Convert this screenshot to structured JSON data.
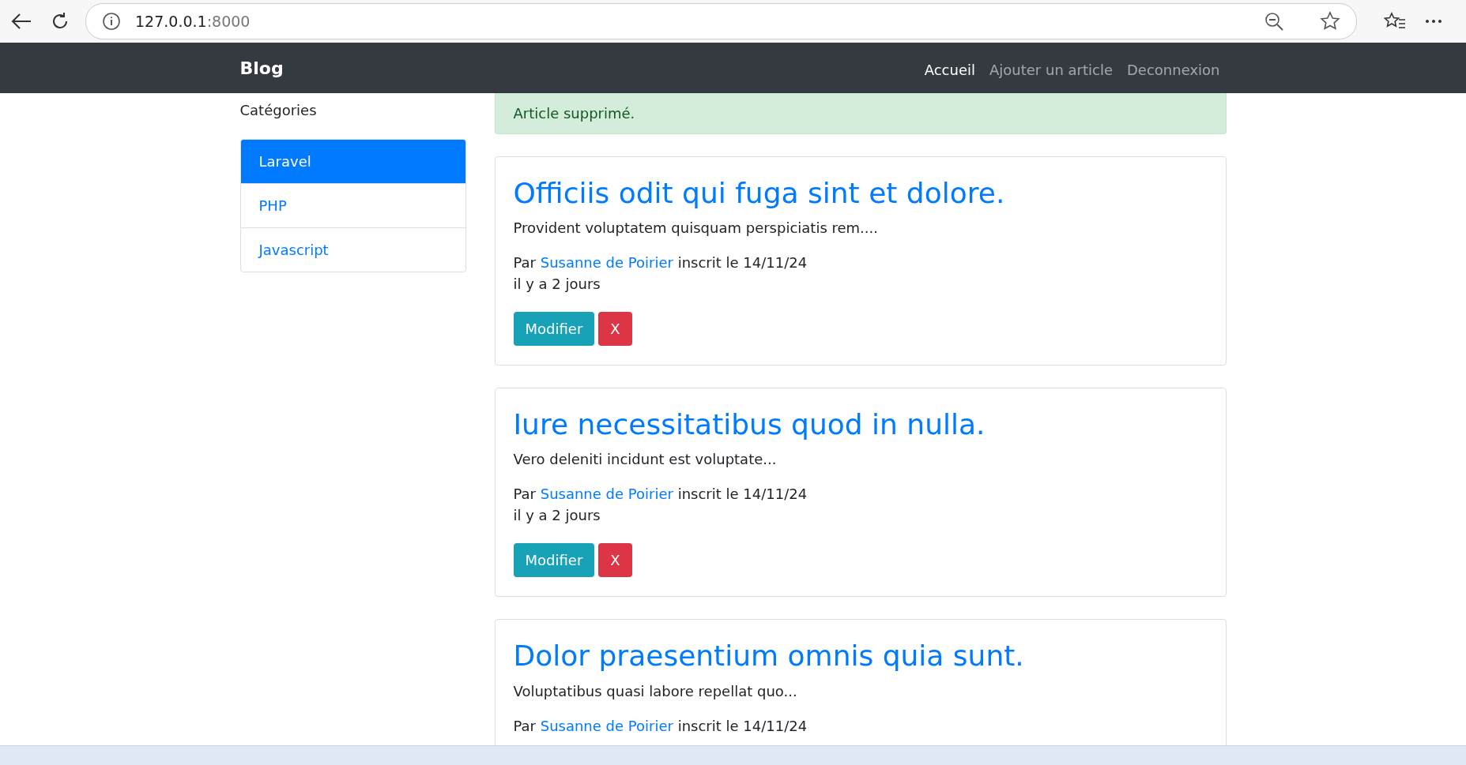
{
  "browser": {
    "url_host": "127.0.0.1",
    "url_port": ":8000"
  },
  "navbar": {
    "brand": "Blog",
    "links": [
      {
        "label": "Accueil",
        "selected": true
      },
      {
        "label": "Ajouter un article",
        "selected": false
      },
      {
        "label": "Deconnexion",
        "selected": false
      }
    ]
  },
  "sidebar": {
    "heading": "Catégories",
    "items": [
      {
        "label": "Laravel",
        "selected": true
      },
      {
        "label": "PHP",
        "selected": false
      },
      {
        "label": "Javascript",
        "selected": false
      }
    ]
  },
  "alert": {
    "message": "Article supprimé."
  },
  "articles": [
    {
      "title": "Officiis odit qui fuga sint et dolore.",
      "excerpt": "Provident voluptatem quisquam perspiciatis rem....",
      "by": "Par",
      "author": "Susanne de Poirier",
      "registered": "inscrit le 14/11/24",
      "age": "il y a 2 jours",
      "buttons": [
        {
          "kind": "edit",
          "label": "Modifier"
        },
        {
          "kind": "delete",
          "label": "X"
        }
      ]
    },
    {
      "title": "Iure necessitatibus quod in nulla.",
      "excerpt": "Vero deleniti incidunt est voluptate...",
      "by": "Par",
      "author": "Susanne de Poirier",
      "registered": "inscrit le 14/11/24",
      "age": "il y a 2 jours",
      "buttons": [
        {
          "kind": "edit",
          "label": "Modifier"
        },
        {
          "kind": "delete",
          "label": "X"
        }
      ]
    },
    {
      "title": "Dolor praesentium omnis quia sunt.",
      "excerpt": "Voluptatibus quasi labore repellat quo...",
      "by": "Par",
      "author": "Susanne de Poirier",
      "registered": "inscrit le 14/11/24"
    }
  ]
}
